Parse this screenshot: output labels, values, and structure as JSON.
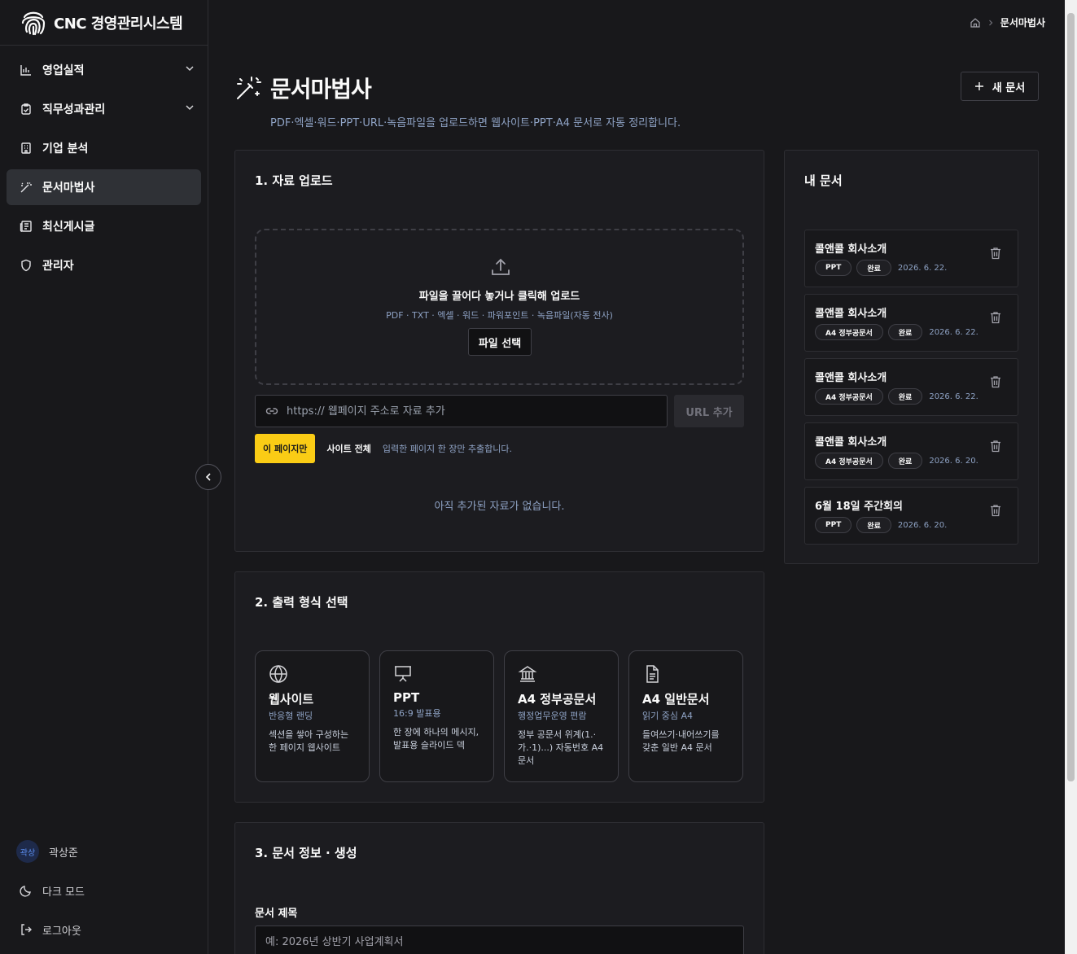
{
  "brand": {
    "title": "CNC 경영관리시스템",
    "logo_icon": "fingerprint-icon"
  },
  "sidebar": {
    "items": [
      {
        "label": "영업실적",
        "icon": "bar-chart-icon",
        "expandable": true
      },
      {
        "label": "직무성과관리",
        "icon": "clipboard-check-icon",
        "expandable": true
      },
      {
        "label": "기업 분석",
        "icon": "building-icon",
        "expandable": false
      },
      {
        "label": "문서마법사",
        "icon": "magic-wand-icon",
        "expandable": false,
        "active": true
      },
      {
        "label": "최신게시글",
        "icon": "newspaper-icon",
        "expandable": false
      },
      {
        "label": "관리자",
        "icon": "shield-icon",
        "expandable": false
      }
    ],
    "user": {
      "avatar": "곽상",
      "name": "곽상준"
    },
    "dark_mode_label": "다크 모드",
    "logout_label": "로그아웃"
  },
  "breadcrumb": {
    "current": "문서마법사"
  },
  "page": {
    "title": "문서마법사",
    "subtitle": "PDF·엑셀·워드·PPT·URL·녹음파일을 업로드하면 웹사이트·PPT·A4 문서로 자동 정리합니다.",
    "new_doc_label": "새 문서"
  },
  "upload": {
    "title": "1. 자료 업로드",
    "drop_title": "파일을 끌어다 놓거나 클릭해 업로드",
    "drop_sub": "PDF · TXT · 엑셀 · 워드 · 파워포인트 · 녹음파일(자동 전사)",
    "select_label": "파일 선택",
    "url_placeholder": "https:// 웹페이지 주소로 자료 추가",
    "url_add_label": "URL 추가",
    "scope_page": "이 페이지만",
    "scope_site": "사이트 전체",
    "scope_hint": "입력한 페이지 한 장만 추출합니다.",
    "empty": "아직 추가된 자료가 없습니다."
  },
  "formats": {
    "title": "2. 출력 형식 선택",
    "items": [
      {
        "name": "웹사이트",
        "sub": "반응형 랜딩",
        "desc": "섹션을 쌓아 구성하는 한 페이지 웹사이트",
        "icon": "globe-icon"
      },
      {
        "name": "PPT",
        "sub": "16:9 발표용",
        "desc": "한 장에 하나의 메시지, 발표용 슬라이드 덱",
        "icon": "presentation-icon"
      },
      {
        "name": "A4 정부공문서",
        "sub": "행정업무운영 편람",
        "desc": "정부 공문서 위계(1.·가.·1)...) 자동번호 A4 문서",
        "icon": "government-building-icon"
      },
      {
        "name": "A4 일반문서",
        "sub": "읽기 중심 A4",
        "desc": "들여쓰기·내어쓰기를 갖춘 일반 A4 문서",
        "icon": "document-icon"
      }
    ]
  },
  "docinfo": {
    "title": "3. 문서 정보 · 생성",
    "field_label": "문서 제목",
    "field_placeholder": "예: 2026년 상반기 사업계획서"
  },
  "my_docs": {
    "title": "내 문서",
    "items": [
      {
        "title": "콜앤콜 회사소개",
        "type": "PPT",
        "status": "완료",
        "date": "2026. 6. 22."
      },
      {
        "title": "콜앤콜 회사소개",
        "type": "A4 정부공문서",
        "status": "완료",
        "date": "2026. 6. 22."
      },
      {
        "title": "콜앤콜 회사소개",
        "type": "A4 정부공문서",
        "status": "완료",
        "date": "2026. 6. 22."
      },
      {
        "title": "콜앤콜 회사소개",
        "type": "A4 정부공문서",
        "status": "완료",
        "date": "2026. 6. 20."
      },
      {
        "title": "6월 18일 주간회의",
        "type": "PPT",
        "status": "완료",
        "date": "2026. 6. 20."
      }
    ]
  },
  "colors": {
    "accent": "#facc15",
    "background": "#18181b",
    "muted_text": "#8ea2c4"
  }
}
